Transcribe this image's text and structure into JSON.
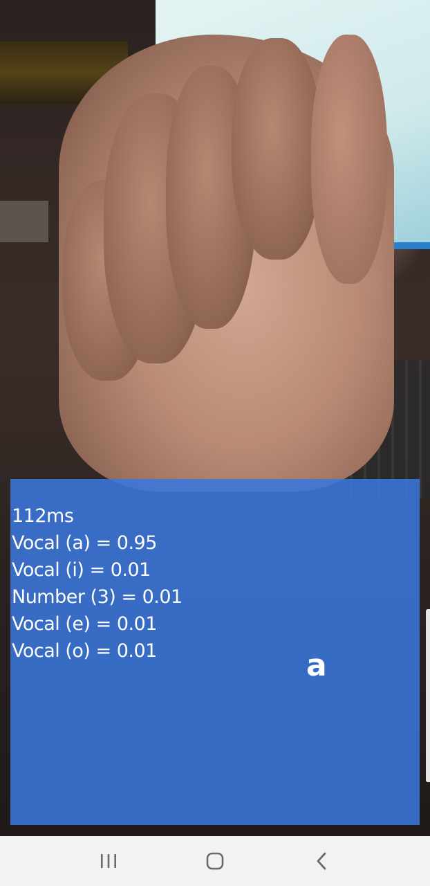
{
  "result": {
    "latency": "112ms",
    "predictions": [
      "Vocal (a) = 0.95",
      "Vocal (i) = 0.01",
      "Number (3) = 0.01",
      "Vocal (e) = 0.01",
      "Vocal (o) = 0.01"
    ],
    "predicted_letter": "a"
  },
  "colors": {
    "panel": "#3A76DC",
    "text": "#FFFFFF",
    "nav_bar": "#F2F2F2",
    "nav_icon": "#6B6B6B"
  },
  "nav": {
    "recents_icon": "recents-icon",
    "home_icon": "home-icon",
    "back_icon": "back-icon"
  }
}
